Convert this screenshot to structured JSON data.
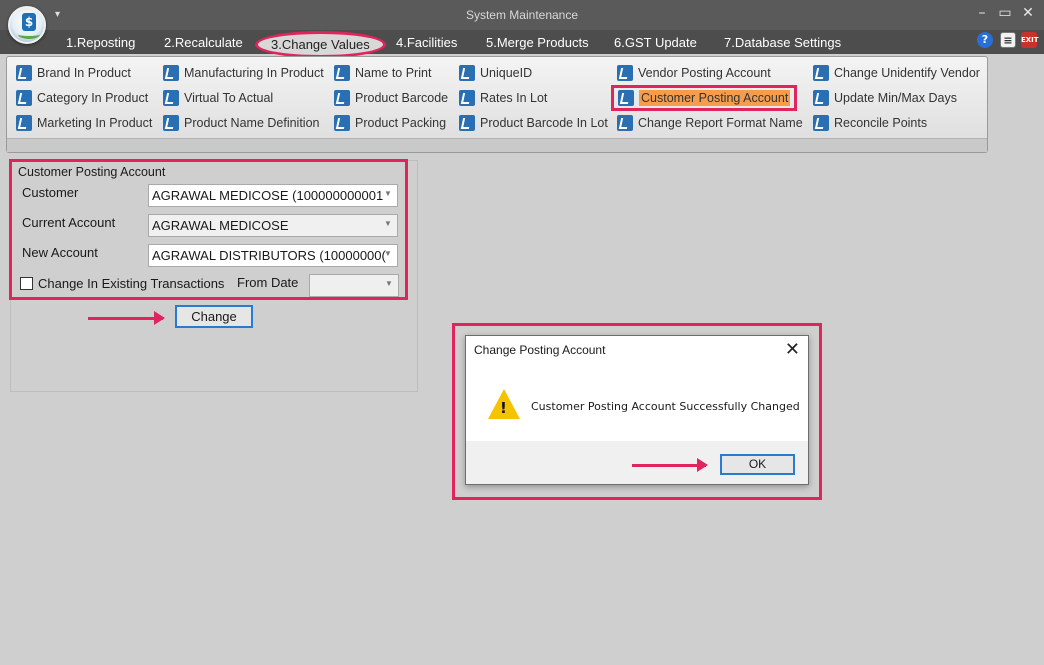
{
  "window": {
    "title": "System Maintenance",
    "controls": {
      "minimize": "–",
      "maximize": "▭",
      "close": "✕"
    }
  },
  "menu": {
    "items": [
      "1.Reposting",
      "2.Recalculate",
      "3.Change Values",
      "4.Facilities",
      "5.Merge Products",
      "6.GST Update",
      "7.Database Settings"
    ],
    "active": "3.Change Values"
  },
  "ribbon": {
    "buttons": [
      "Brand In Product",
      "Category In Product",
      "Marketing In Product",
      "Manufacturing In Product",
      "Virtual To Actual",
      "Product Name Definition",
      "Name to Print",
      "Product Barcode",
      "Product Packing",
      "UniqueID",
      "Rates In Lot",
      "Product Barcode In Lot",
      "Vendor Posting Account",
      "Customer Posting Account",
      "Change Report Format Name",
      "Change Unidentify Vendor",
      "Update Min/Max Days",
      "Reconcile Points"
    ],
    "selected": "Customer Posting Account"
  },
  "panel": {
    "legend": "Customer Posting Account",
    "customer_label": "Customer",
    "customer_value": "AGRAWAL MEDICOSE (100000000001",
    "current_account_label": "Current Account",
    "current_account_value": "AGRAWAL MEDICOSE",
    "new_account_label": "New Account",
    "new_account_value": "AGRAWAL DISTRIBUTORS (10000000(",
    "change_existing_label": "Change In Existing Transactions",
    "change_existing_checked": false,
    "from_date_label": "From Date",
    "from_date_value": "",
    "change_button": "Change"
  },
  "dialog": {
    "title": "Change Posting Account",
    "message": "Customer Posting Account Successfully Changed",
    "ok_button": "OK",
    "close_glyph": "✕",
    "warning_glyph": "!"
  },
  "colors": {
    "annotation": "#e0245e",
    "ribbon_selected": "#f59d4d",
    "button_focus": "#2a7ad0"
  },
  "icons": [
    "app-logo-icon",
    "quick-access-arrow-icon",
    "help-icon",
    "page-icon",
    "exit-icon",
    "ribbon-item-icon",
    "warning-icon",
    "close-icon",
    "dropdown-arrow-icon"
  ]
}
